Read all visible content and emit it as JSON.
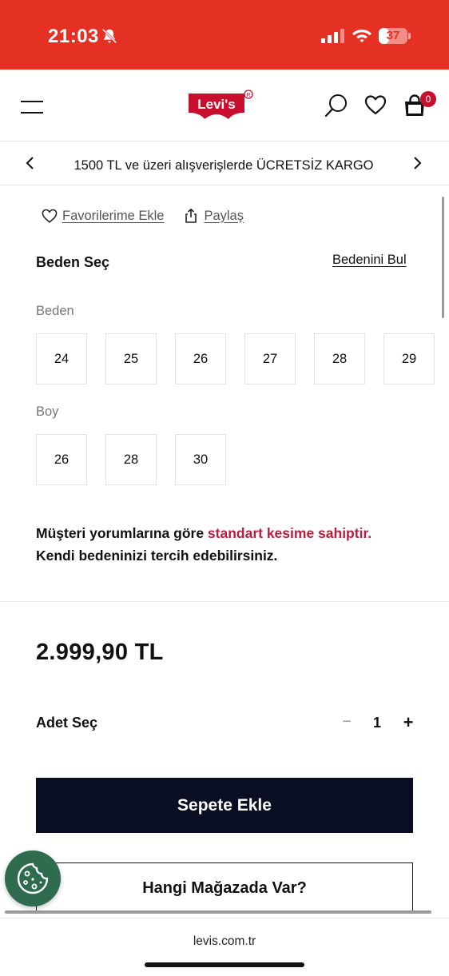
{
  "status_bar": {
    "time": "21:03",
    "battery": "37",
    "battery_level": 0.37
  },
  "header": {
    "brand": "Levi's",
    "cart_count": "0"
  },
  "promo": {
    "text": "1500 TL ve üzeri alışverişlerde ÜCRETSİZ KARGO"
  },
  "actions": {
    "favorite_label": "Favorilerime Ekle",
    "share_label": "Paylaş"
  },
  "size": {
    "title": "Beden Seç",
    "guide_label": "Bedenini Bul",
    "waist_label": "Beden",
    "waist_options": [
      "24",
      "25",
      "26",
      "27",
      "28",
      "29"
    ],
    "length_label": "Boy",
    "length_options": [
      "26",
      "28",
      "30"
    ]
  },
  "fit_note": {
    "prefix": "Müşteri yorumlarına göre ",
    "highlight": "standart kesime sahiptir.",
    "suffix": "Kendi bedeninizi tercih edebilirsiniz."
  },
  "product": {
    "price": "2.999,90 TL"
  },
  "quantity": {
    "label": "Adet Seç",
    "minus": "−",
    "value": "1",
    "plus": "+"
  },
  "buttons": {
    "add_to_cart": "Sepete Ekle",
    "find_in_store": "Hangi Mağazada Var?"
  },
  "browser": {
    "url": "levis.com.tr"
  },
  "colors": {
    "status_bar": "#e53024",
    "brand_red": "#c8102e",
    "accent": "#b5203e",
    "primary_button": "#0a0e22",
    "cookie": "#2f6b4f"
  }
}
